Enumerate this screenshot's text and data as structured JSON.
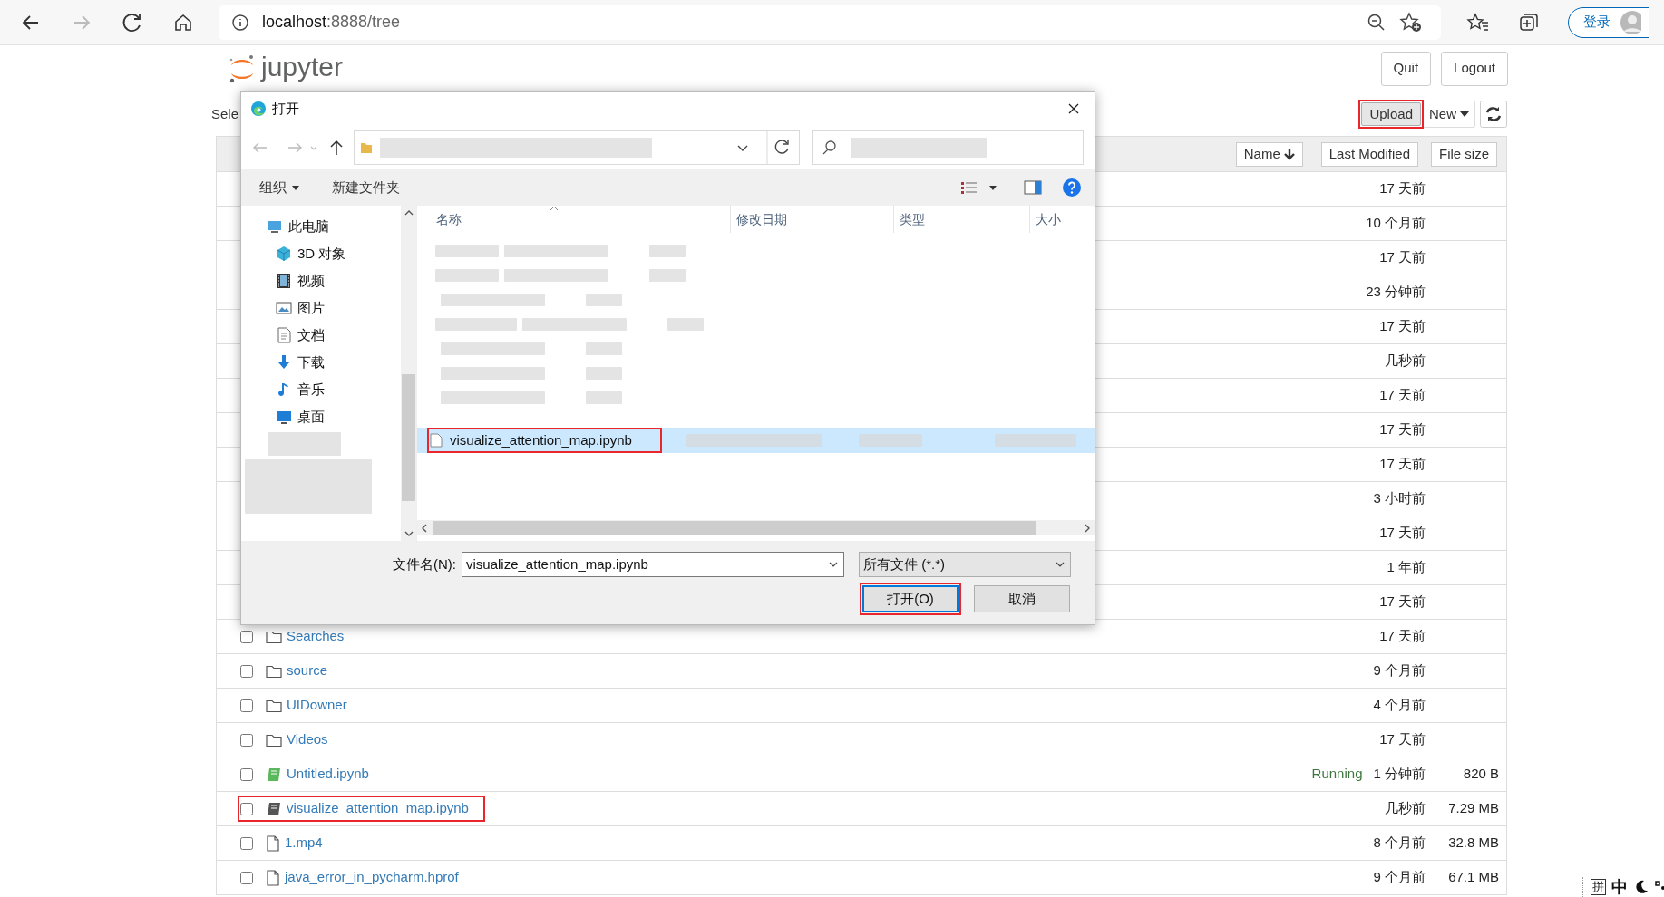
{
  "browser": {
    "url_host": "localhost",
    "url_path": ":8888/tree",
    "forward_disabled": true,
    "sign_in_label": "登录"
  },
  "header": {
    "logo": "jupyter",
    "buttons": [
      "Quit",
      "Logout"
    ]
  },
  "toolbar": {
    "select_label": "Sele",
    "upload": {
      "label": "Upload",
      "highlighted": true
    },
    "new_label": "New"
  },
  "table": {
    "sort_buttons": [
      {
        "label": "Name",
        "sorted": true
      },
      {
        "label": "Last Modified",
        "sorted": false
      },
      {
        "label": "File size",
        "sorted": false
      }
    ],
    "rows": [
      {
        "modified": "17 天前"
      },
      {
        "modified": "10 个月前"
      },
      {
        "modified": "17 天前"
      },
      {
        "modified": "23 分钟前"
      },
      {
        "modified": "17 天前"
      },
      {
        "modified": "几秒前"
      },
      {
        "modified": "17 天前"
      },
      {
        "modified": "17 天前"
      },
      {
        "modified": "17 天前"
      },
      {
        "modified": "3 小时前"
      },
      {
        "modified": "17 天前"
      },
      {
        "modified": "1 年前"
      },
      {
        "modified": "17 天前"
      },
      {
        "kind": "folder",
        "name": "Searches",
        "modified": "17 天前",
        "checked": false,
        "highlighted": false
      },
      {
        "kind": "folder",
        "name": "source",
        "modified": "9 个月前",
        "checked": false,
        "highlighted": false
      },
      {
        "kind": "folder",
        "name": "UIDowner",
        "modified": "4 个月前",
        "checked": false,
        "highlighted": false
      },
      {
        "kind": "folder",
        "name": "Videos",
        "modified": "17 天前",
        "checked": false,
        "highlighted": false
      },
      {
        "kind": "notebook",
        "name": "Untitled.ipynb",
        "status": "Running",
        "modified": "1 分钟前",
        "size": "820 B",
        "checked": false,
        "highlighted": false
      },
      {
        "kind": "notebook",
        "name": "visualize_attention_map.ipynb",
        "modified": "几秒前",
        "size": "7.29 MB",
        "checked": false,
        "highlighted": true
      },
      {
        "kind": "file",
        "name": "1.mp4",
        "modified": "8 个月前",
        "size": "32.8 MB",
        "checked": false,
        "highlighted": false
      },
      {
        "kind": "file",
        "name": "java_error_in_pycharm.hprof",
        "modified": "9 个月前",
        "size": "67.1 MB",
        "checked": false,
        "highlighted": false
      }
    ]
  },
  "dialog": {
    "title": "打开",
    "toolbar": [
      {
        "label": "组织",
        "dropdown": true
      },
      {
        "label": "新建文件夹",
        "dropdown": false
      }
    ],
    "nav": [
      {
        "label": "此电脑",
        "kind": "pc",
        "children": [
          {
            "label": "3D 对象",
            "kind": "cube"
          },
          {
            "label": "视频",
            "kind": "video"
          },
          {
            "label": "图片",
            "kind": "picture"
          },
          {
            "label": "文档",
            "kind": "doc"
          },
          {
            "label": "下载",
            "kind": "download"
          },
          {
            "label": "音乐",
            "kind": "music"
          },
          {
            "label": "桌面",
            "kind": "desktop"
          }
        ]
      }
    ],
    "columns": [
      "名称",
      "修改日期",
      "类型",
      "大小"
    ],
    "selected_file": {
      "name": "visualize_attention_map.ipynb",
      "highlighted": true
    },
    "filename_label": "文件名(N):",
    "filename_value": "visualize_attention_map.ipynb",
    "filter": "所有文件 (*.*)",
    "buttons": [
      {
        "label": "打开(O)",
        "kind": "primary",
        "highlighted": true
      },
      {
        "label": "取消",
        "kind": "secondary",
        "highlighted": false
      }
    ]
  },
  "ime": [
    "拼",
    "中"
  ]
}
